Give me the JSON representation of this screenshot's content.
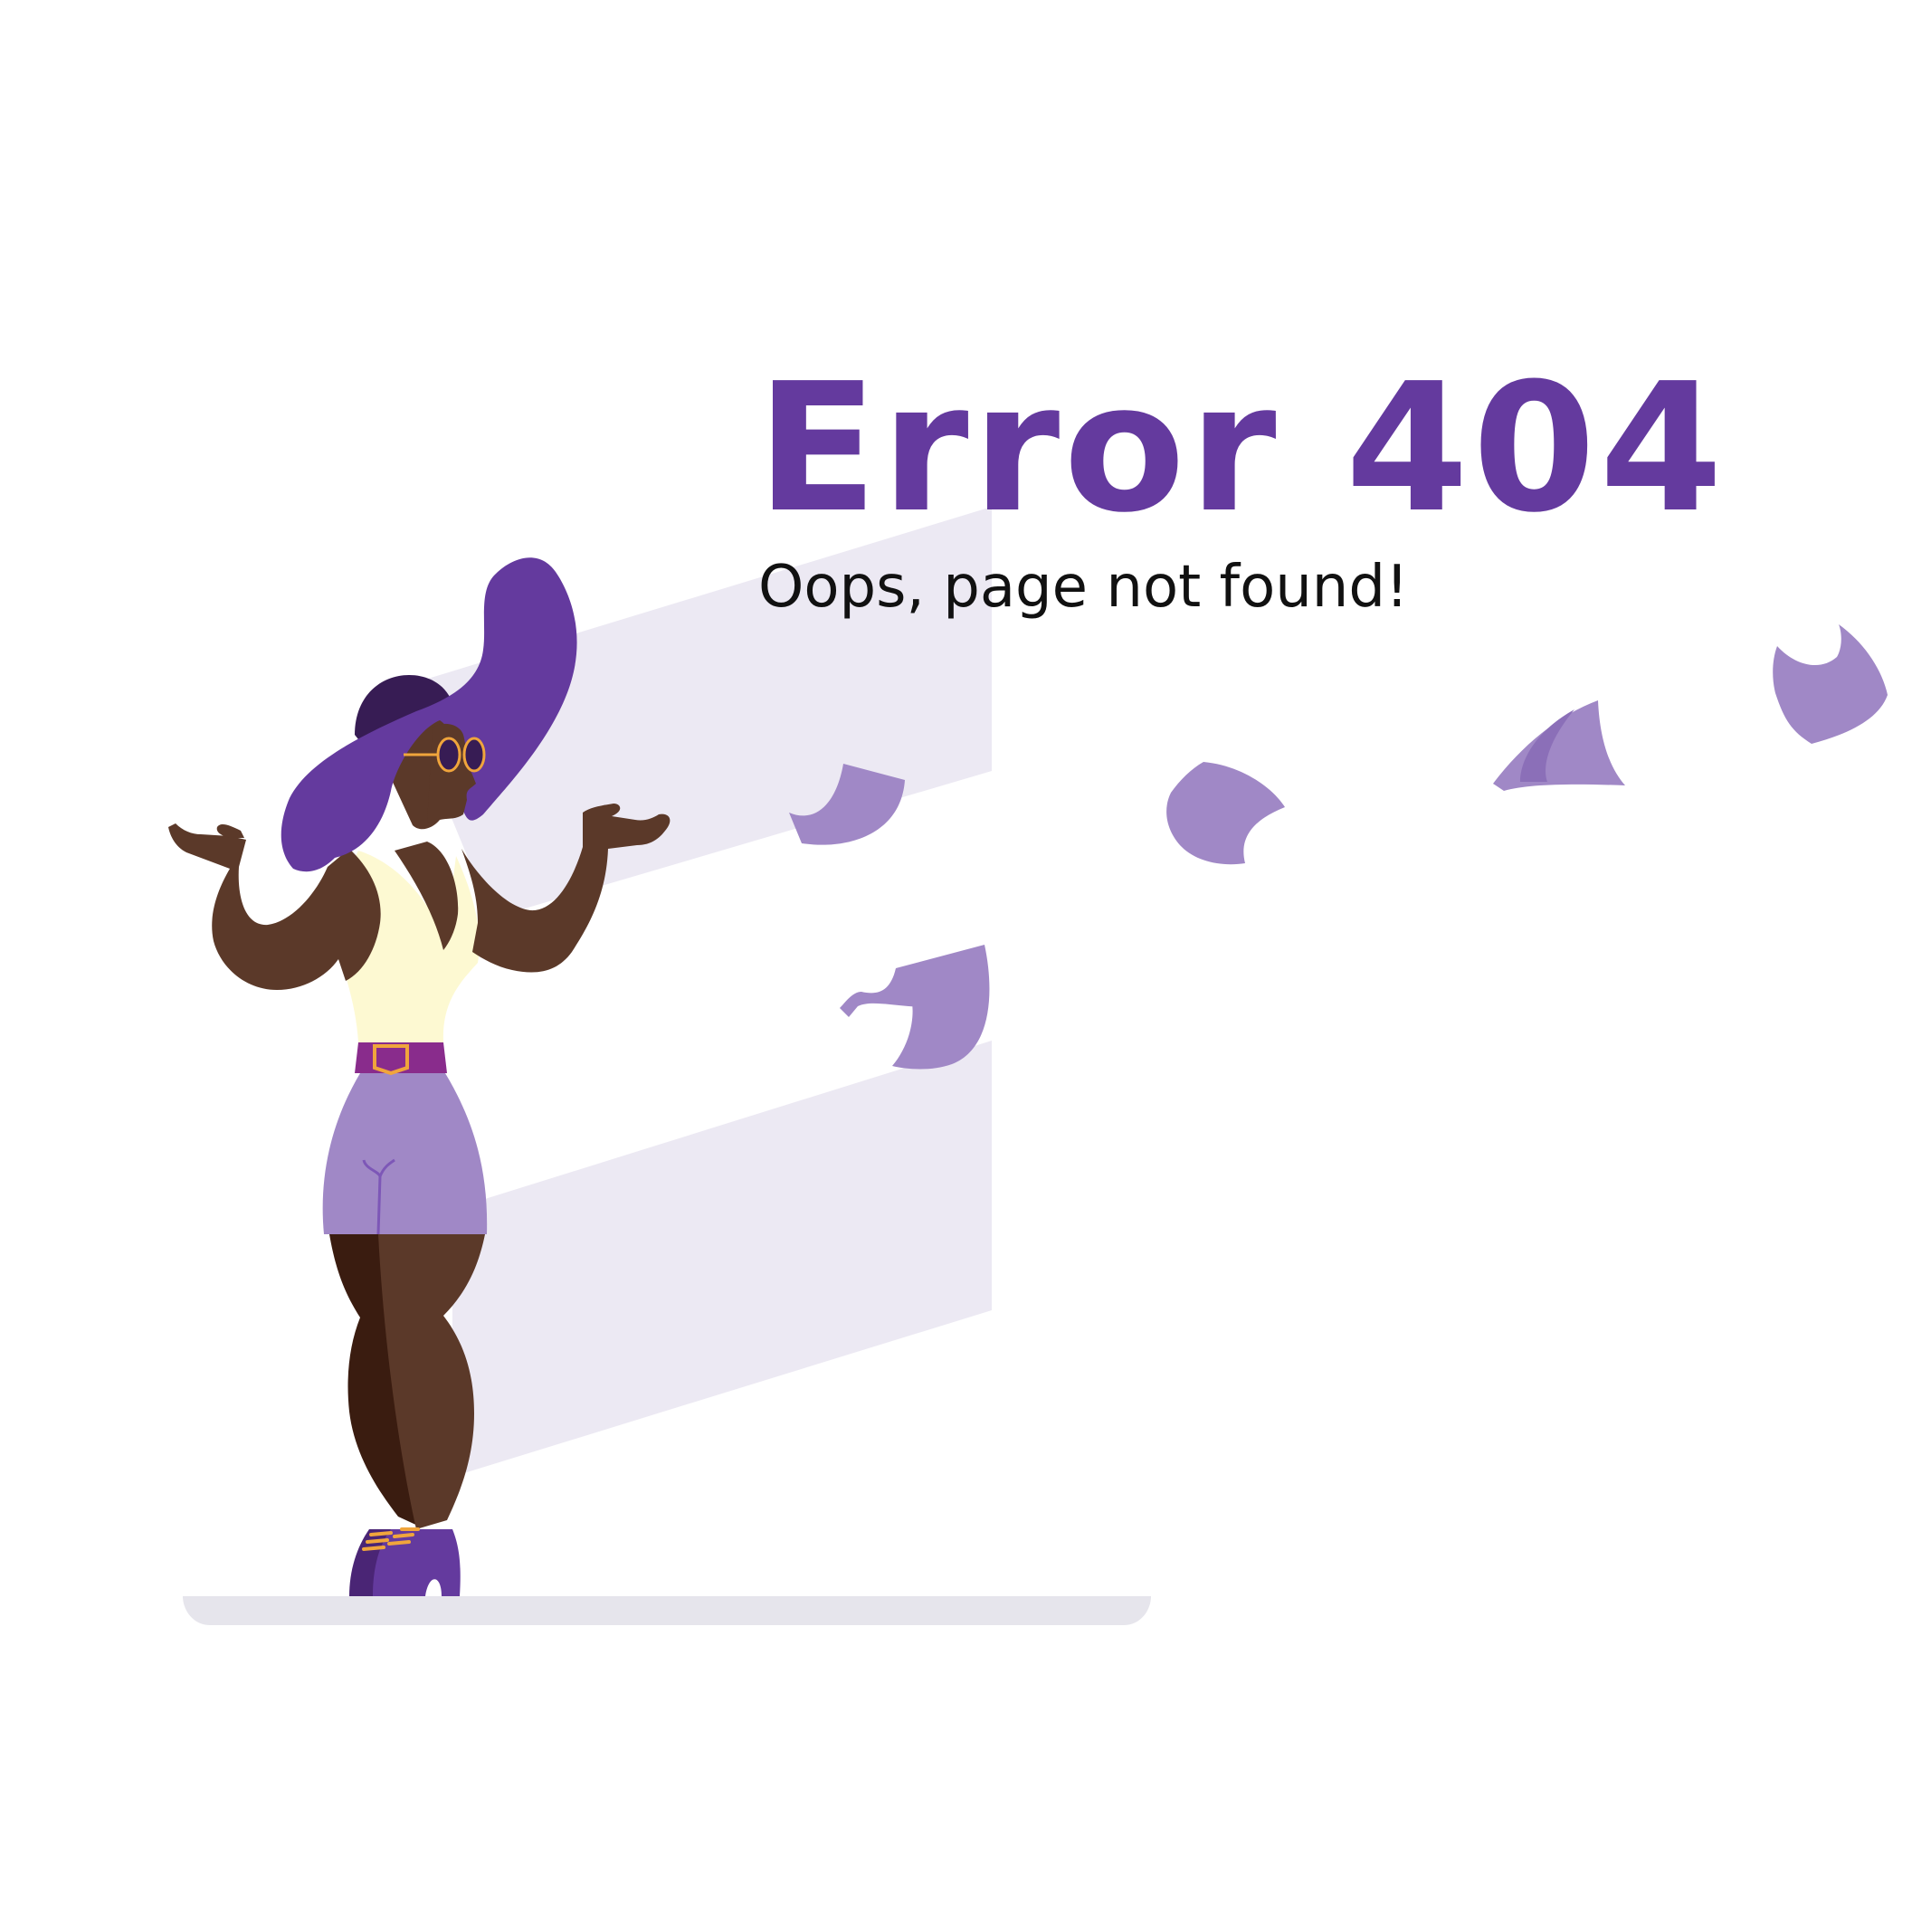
{
  "error_page": {
    "title": "Error 404",
    "message": "Oops, page not found!"
  },
  "colors": {
    "accent": "#643a9e",
    "light_purple": "#a088c6",
    "shadow_panel": "#ece9f3",
    "floor": "#e6e5ec",
    "skin": "#5b3929",
    "top": "#fdf9d2",
    "text": "#111111"
  }
}
